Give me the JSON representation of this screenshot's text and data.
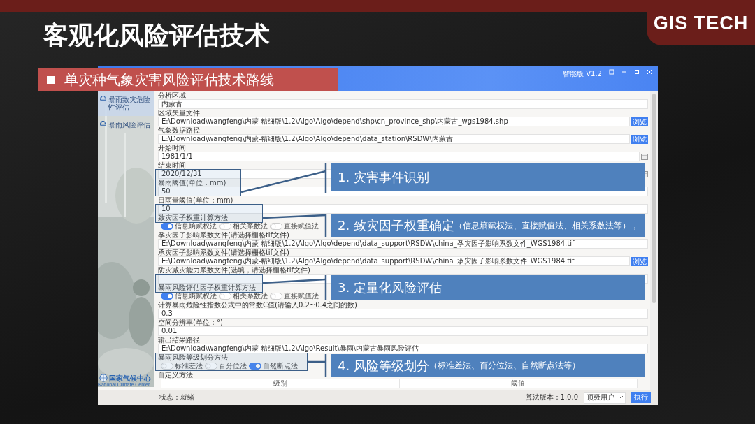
{
  "slide": {
    "brand": "GIS TECH",
    "title": "客观化风险评估技术",
    "subtitle": "单灾种气象灾害风险评估技术路线"
  },
  "app": {
    "version": "智能版 V1.2",
    "sidebar": {
      "items": [
        {
          "label": "暴雨致灾危险性评估",
          "selected": true
        },
        {
          "label": "暴雨风险评估",
          "selected": false
        }
      ],
      "logo": {
        "name_cn": "国家气候中心",
        "name_en": "National Climate Center"
      }
    },
    "form": [
      {
        "kind": "text",
        "label": "分析区域",
        "value": "内蒙古"
      },
      {
        "kind": "text",
        "label": "区域矢量文件",
        "value": "E:\\Download\\wangfeng\\内蒙-精细版\\1.2\\Algo\\Algo\\depend\\shp\\cn_province_shp\\内蒙古_wgs1984.shp",
        "browse": "浏览"
      },
      {
        "kind": "text",
        "label": "气象数据路径",
        "value": "E:\\Download\\wangfeng\\内蒙-精细版\\1.2\\Algo\\Algo\\depend\\data_station\\RSDW\\内蒙古",
        "browse": "浏览"
      },
      {
        "kind": "date",
        "label": "开始时间",
        "value": "1981/1/1"
      },
      {
        "kind": "date",
        "label": "结束时间",
        "value": "2020/12/31"
      },
      {
        "kind": "text",
        "label": "暴雨阈值(单位：mm)",
        "value": "50"
      },
      {
        "kind": "text",
        "label": "日雨量阈值(单位：mm)",
        "value": "10"
      },
      {
        "kind": "options",
        "label": "致灾因子权重计算方法",
        "options": [
          {
            "label": "信息熵赋权法",
            "on": true
          },
          {
            "label": "相关系数法",
            "on": false
          },
          {
            "label": "直接赋值法",
            "on": false
          }
        ]
      },
      {
        "kind": "text",
        "label": "孕灾因子影响系数文件(请选择栅格tif文件)",
        "value": "E:\\Download\\wangfeng\\内蒙-精细版\\1.2\\Algo\\Algo\\depend\\data_support\\RSDW\\china_孕灾因子影响系数文件_WGS1984.tif"
      },
      {
        "kind": "text",
        "label": "承灾因子影响系数文件(请选择栅格tif文件)",
        "value": "E:\\Download\\wangfeng\\内蒙-精细版\\1.2\\Algo\\Algo\\depend\\data_support\\RSDW\\china_承灾因子影响系数文件_WGS1984.tif",
        "browse": "浏览"
      },
      {
        "kind": "text",
        "label": "防灾减灾能力系数文件(选填，请选择栅格tif文件)"
      },
      {
        "kind": "options",
        "label": "暴雨风险评估因子权重计算方法",
        "options": [
          {
            "label": "信息熵赋权法",
            "on": true
          },
          {
            "label": "相关系数法",
            "on": false
          },
          {
            "label": "直接赋值法",
            "on": false
          }
        ]
      },
      {
        "kind": "text",
        "label": "计算暴雨危险性指数公式中的常数C值(请输入0.2~0.4之间的数)",
        "value": "0.3"
      },
      {
        "kind": "text",
        "label": "空间分辨率(单位：°)",
        "value": "0.01"
      },
      {
        "kind": "text",
        "label": "输出结果路径",
        "value": "E:\\Download\\wangfeng\\内蒙-精细版\\1.2\\Algo\\Result\\暴雨\\内蒙古暴雨风险评估"
      },
      {
        "kind": "options",
        "label": "暴雨风险等级划分方法",
        "options": [
          {
            "label": "标准差法",
            "on": false
          },
          {
            "label": "百分位法",
            "on": false
          },
          {
            "label": "自然断点法",
            "on": true
          }
        ]
      },
      {
        "kind": "table",
        "label": "自定义方法",
        "columns": [
          "级别",
          "阈值"
        ]
      }
    ],
    "status": "状态：就绪",
    "algo_version": "算法版本：1.0.0",
    "user_select": "顶级用户",
    "run_button": "执行"
  },
  "callouts": [
    {
      "title": "1. 灾害事件识别"
    },
    {
      "title": "2. 致灾因子权重确定",
      "note": "（信息熵赋权法、直接赋值法、相关系数法等），"
    },
    {
      "title": "3. 定量化风险评估"
    },
    {
      "title": "4. 风险等级划分",
      "note": "（标准差法、百分位法、自然断点法等）"
    }
  ]
}
